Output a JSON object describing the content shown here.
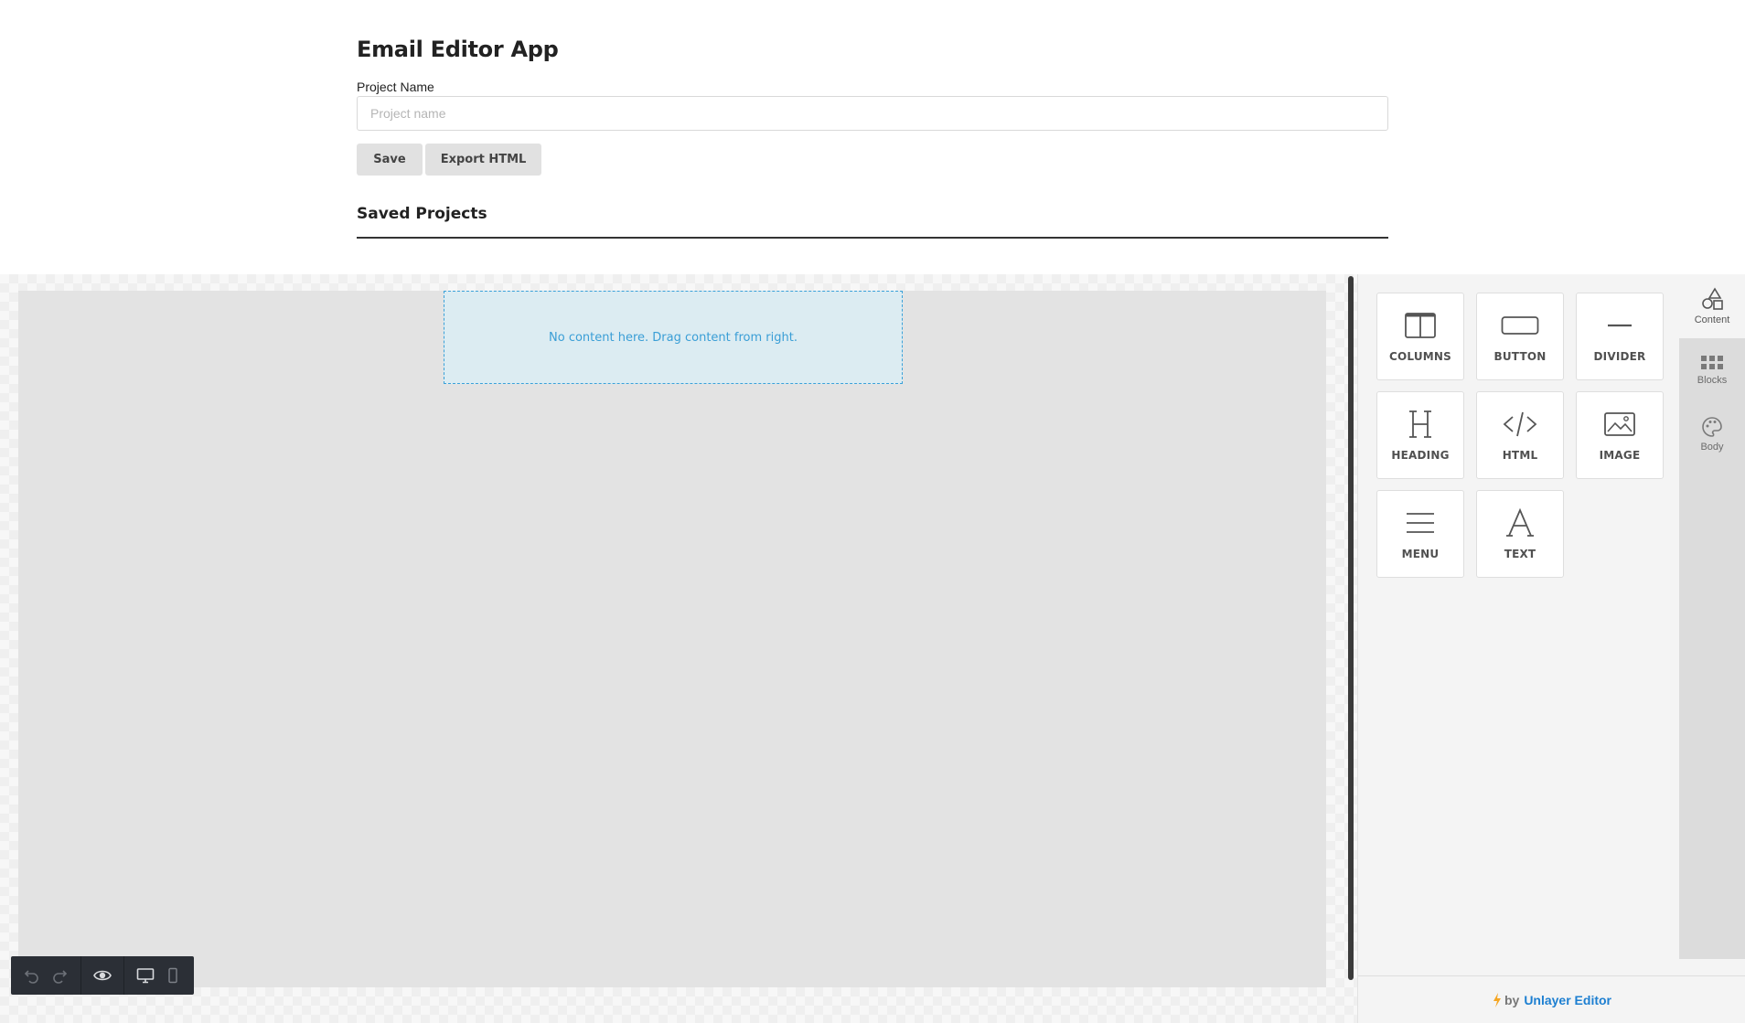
{
  "app": {
    "title": "Email Editor App",
    "project_label": "Project Name",
    "project_placeholder": "Project name",
    "project_value": "",
    "save_label": "Save",
    "export_label": "Export HTML",
    "saved_projects_title": "Saved Projects"
  },
  "editor": {
    "empty_message": "No content here. Drag content from right.",
    "toolbar": {
      "icons": [
        "undo-icon",
        "redo-icon",
        "preview-eye-icon",
        "desktop-icon",
        "mobile-icon"
      ]
    },
    "tools": [
      {
        "label": "COLUMNS",
        "icon": "columns-icon"
      },
      {
        "label": "BUTTON",
        "icon": "button-icon"
      },
      {
        "label": "DIVIDER",
        "icon": "divider-icon"
      },
      {
        "label": "HEADING",
        "icon": "heading-icon"
      },
      {
        "label": "HTML",
        "icon": "html-code-icon"
      },
      {
        "label": "IMAGE",
        "icon": "image-icon"
      },
      {
        "label": "MENU",
        "icon": "menu-icon"
      },
      {
        "label": "TEXT",
        "icon": "text-icon"
      }
    ],
    "tabs": [
      {
        "label": "Content",
        "icon": "shapes-icon",
        "active": true
      },
      {
        "label": "Blocks",
        "icon": "blocks-grid-icon",
        "active": false
      },
      {
        "label": "Body",
        "icon": "palette-icon",
        "active": false
      }
    ],
    "branding": {
      "prefix": "by",
      "link": "Unlayer Editor"
    }
  },
  "colors": {
    "accent": "#1d7fd1",
    "dropzone_border": "#3aa1d9",
    "dropzone_bg": "#dcecf2",
    "toolbar_bg": "#2b2f36",
    "bolt": "#f5a623"
  }
}
